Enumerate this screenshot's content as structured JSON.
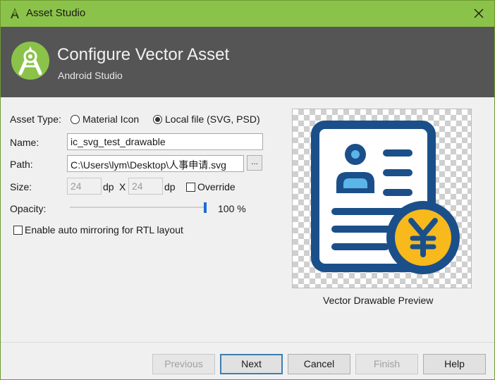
{
  "window": {
    "title": "Asset Studio",
    "accent_color": "#8bc34a",
    "header_bg": "#555555"
  },
  "header": {
    "title": "Configure Vector Asset",
    "subtitle": "Android Studio"
  },
  "form": {
    "asset_type_label": "Asset Type:",
    "asset_type_options": [
      "Material Icon",
      "Local file (SVG, PSD)"
    ],
    "asset_type_selected": "Local file (SVG, PSD)",
    "name_label": "Name:",
    "name_value": "ic_svg_test_drawable",
    "path_label": "Path:",
    "path_value": "C:\\Users\\lym\\Desktop\\人事申请.svg",
    "browse_label": "...",
    "size_label": "Size:",
    "width_value": "24",
    "height_value": "24",
    "dp_unit": "dp",
    "size_separator": "X",
    "override_label": "Override",
    "override_checked": false,
    "opacity_label": "Opacity:",
    "opacity_percent": 100,
    "opacity_text": "100 %",
    "rtl_label": "Enable auto mirroring for RTL layout",
    "rtl_checked": false
  },
  "preview": {
    "caption": "Vector Drawable Preview",
    "icon": "document-person-yen-icon",
    "colors": {
      "dark_blue": "#1b4f8a",
      "light_blue": "#5bb5e8",
      "yellow": "#f7b91c"
    }
  },
  "footer": {
    "previous_label": "Previous",
    "next_label": "Next",
    "cancel_label": "Cancel",
    "finish_label": "Finish",
    "help_label": "Help"
  }
}
